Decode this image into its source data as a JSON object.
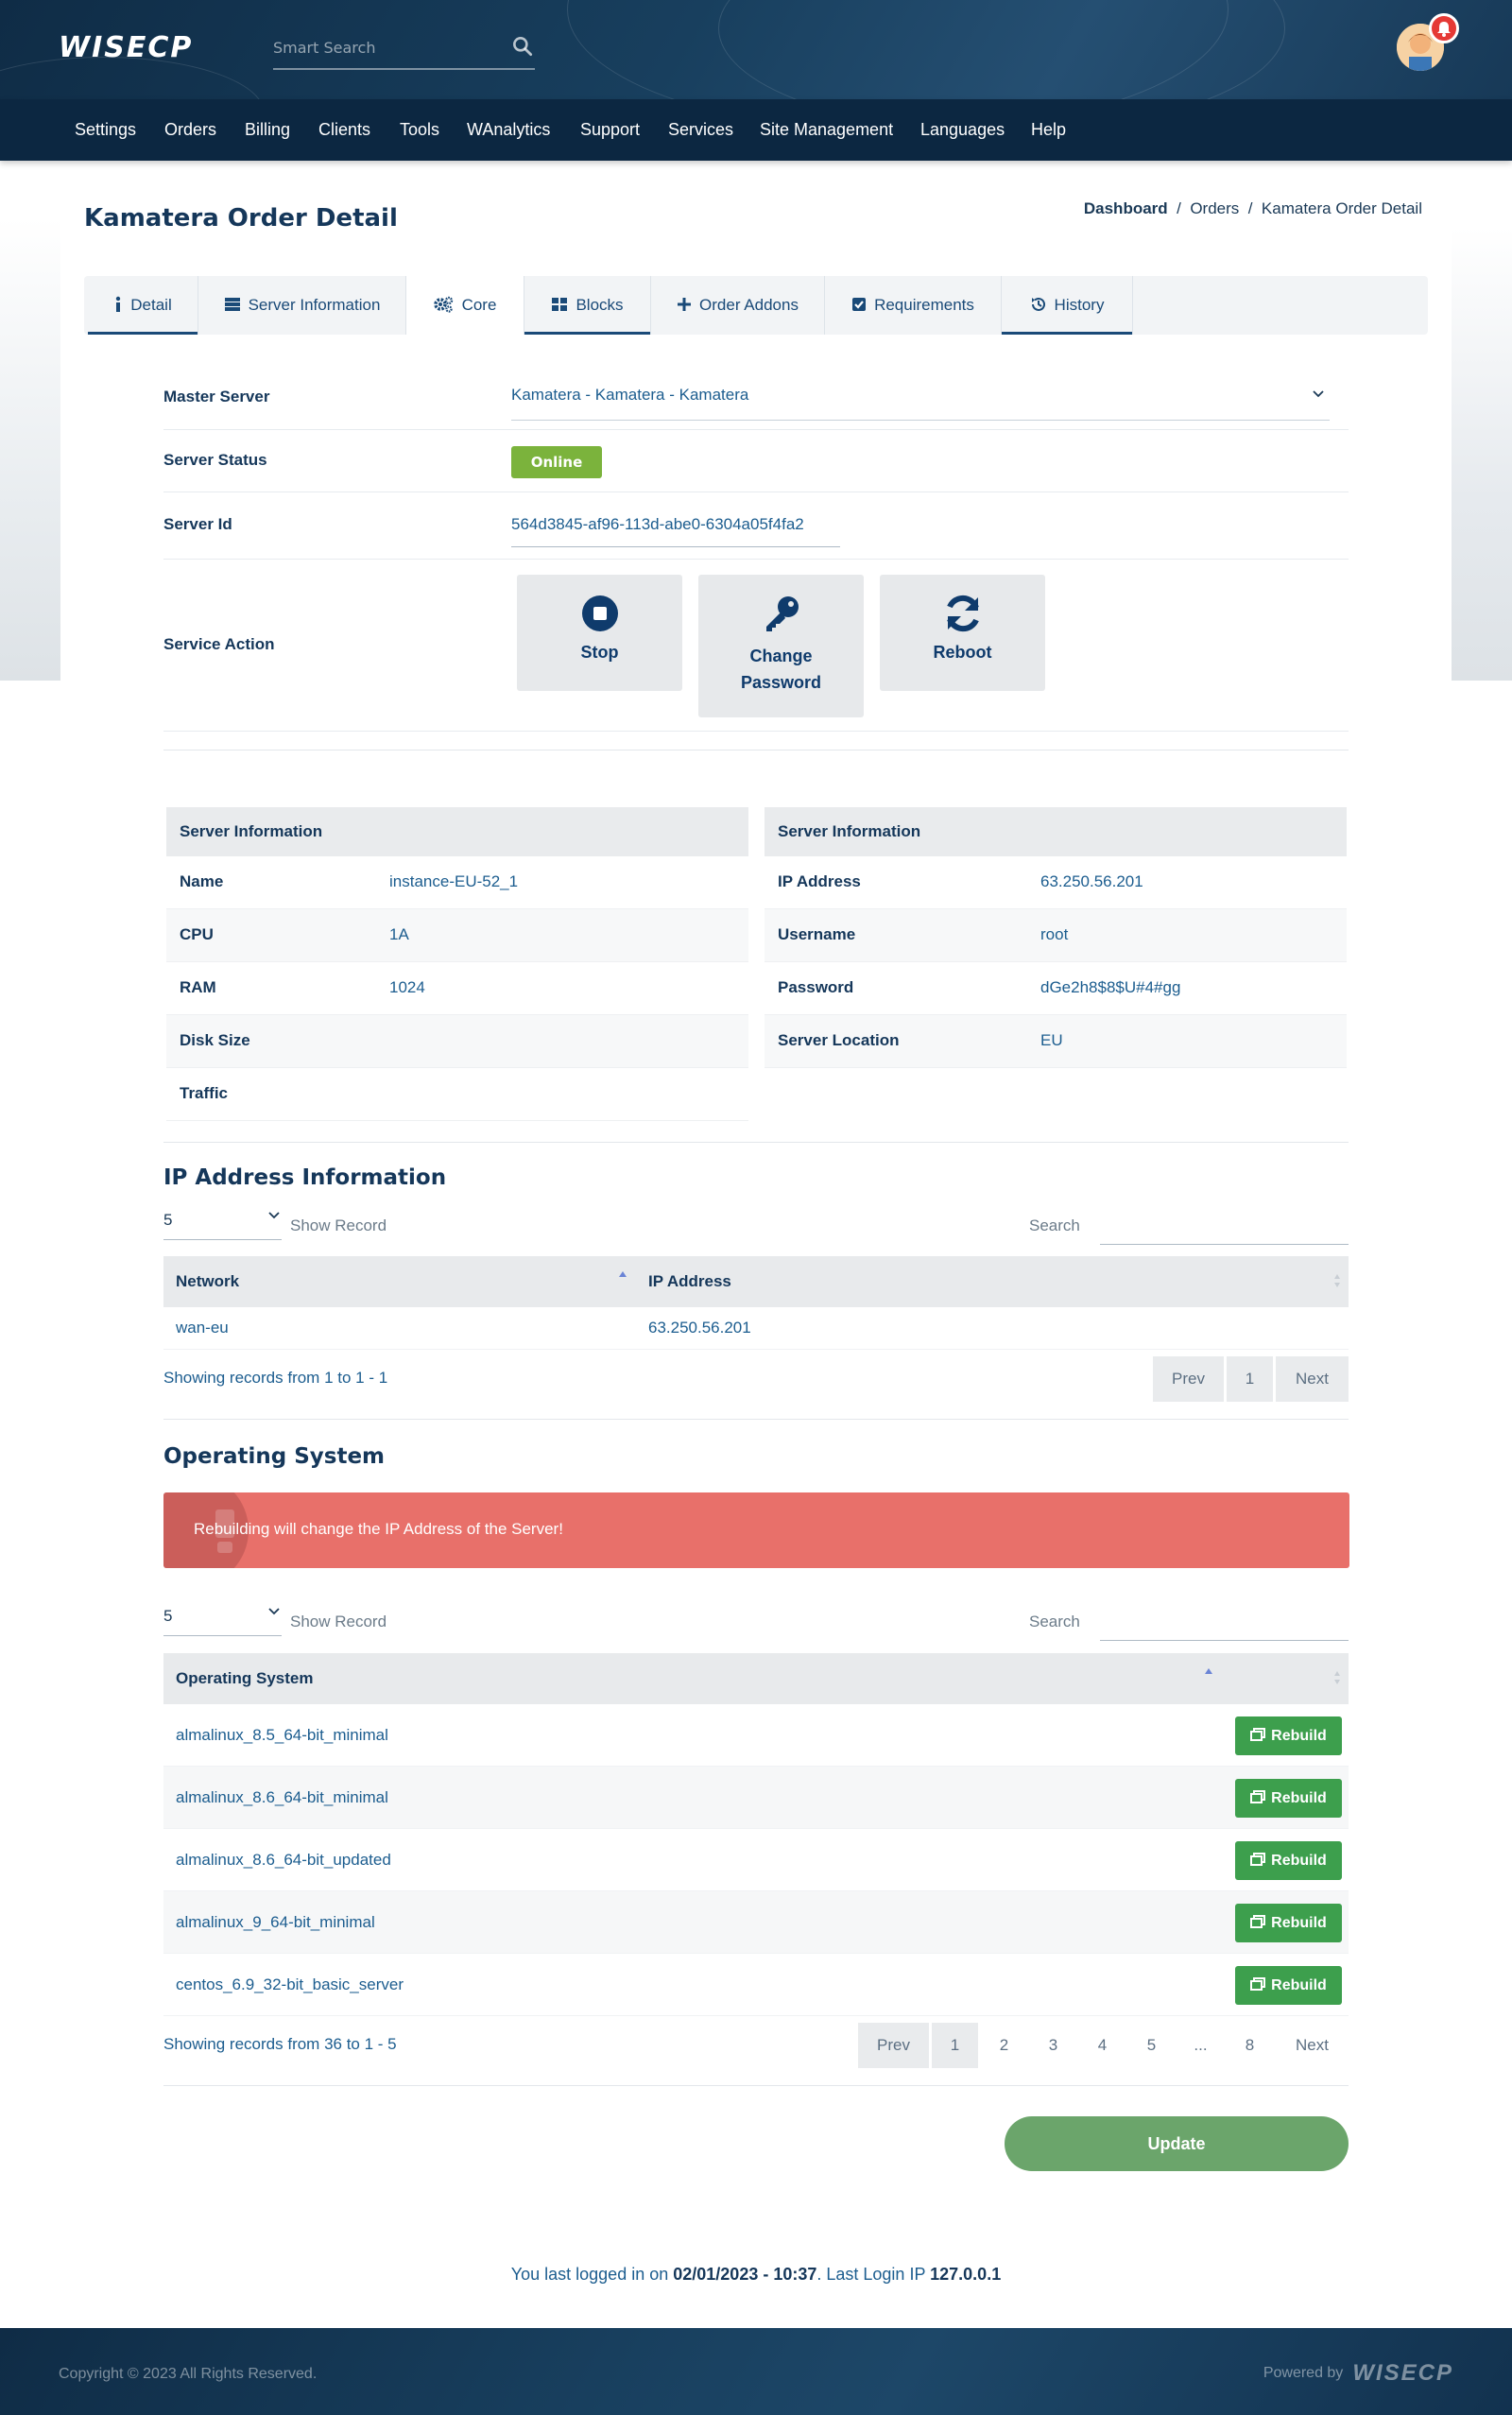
{
  "header": {
    "logo": "WISECP",
    "search_placeholder": "Smart Search",
    "nav": [
      "Settings",
      "Orders",
      "Billing",
      "Clients",
      "Tools",
      "WAnalytics",
      "Support",
      "Services",
      "Site Management",
      "Languages",
      "Help"
    ]
  },
  "page": {
    "title": "Kamatera Order Detail",
    "breadcrumb": [
      "Dashboard",
      "Orders",
      "Kamatera Order Detail"
    ]
  },
  "tabs": [
    {
      "label": "Detail",
      "icon": "info-icon"
    },
    {
      "label": "Server Information",
      "icon": "server-icon"
    },
    {
      "label": "Core",
      "icon": "cogs-icon"
    },
    {
      "label": "Blocks",
      "icon": "blocks-icon"
    },
    {
      "label": "Order Addons",
      "icon": "plus-icon"
    },
    {
      "label": "Requirements",
      "icon": "check-square-icon"
    },
    {
      "label": "History",
      "icon": "history-icon"
    }
  ],
  "active_tab": "Core",
  "form": {
    "master_server_label": "Master Server",
    "master_server_value": "Kamatera - Kamatera - Kamatera",
    "server_status_label": "Server Status",
    "server_status_value": "Online",
    "server_id_label": "Server Id",
    "server_id_value": "564d3845-af96-113d-abe0-6304a05f4fa2",
    "service_action_label": "Service Action"
  },
  "actions": [
    {
      "label": "Stop",
      "icon": "stop-icon"
    },
    {
      "label": "Change Password",
      "icon": "key-icon"
    },
    {
      "label": "Reboot",
      "icon": "reboot-icon"
    }
  ],
  "server_info_left": {
    "title": "Server Information",
    "rows": [
      {
        "key": "Name",
        "value": "instance-EU-52_1"
      },
      {
        "key": "CPU",
        "value": "1A"
      },
      {
        "key": "RAM",
        "value": "1024"
      },
      {
        "key": "Disk Size",
        "value": ""
      },
      {
        "key": "Traffic",
        "value": ""
      }
    ]
  },
  "server_info_right": {
    "title": "Server Information",
    "rows": [
      {
        "key": "IP Address",
        "value": "63.250.56.201"
      },
      {
        "key": "Username",
        "value": "root"
      },
      {
        "key": "Password",
        "value": "dGe2h8$8$U#4#gg"
      },
      {
        "key": "Server Location",
        "value": "EU"
      }
    ]
  },
  "ip_section": {
    "title": "IP Address Information",
    "page_length": "5",
    "show_record": "Show Record",
    "search_label": "Search",
    "columns": [
      "Network",
      "IP Address"
    ],
    "rows": [
      [
        "wan-eu",
        "63.250.56.201"
      ]
    ],
    "info": "Showing records from 1 to 1 - 1",
    "pagination": [
      "Prev",
      "1",
      "Next"
    ]
  },
  "os_section": {
    "title": "Operating System",
    "alert": "Rebuilding will change the IP Address of the Server!",
    "page_length": "5",
    "show_record": "Show Record",
    "search_label": "Search",
    "column": "Operating System",
    "button_label": "Rebuild",
    "rows": [
      "almalinux_8.5_64-bit_minimal",
      "almalinux_8.6_64-bit_minimal",
      "almalinux_8.6_64-bit_updated",
      "almalinux_9_64-bit_minimal",
      "centos_6.9_32-bit_basic_server"
    ],
    "info": "Showing records from 36 to 1 - 5",
    "pagination": [
      "Prev",
      "1",
      "2",
      "3",
      "4",
      "5",
      "...",
      "8",
      "Next"
    ]
  },
  "update_label": "Update",
  "last_login": {
    "prefix": "You last logged in on ",
    "datetime": "02/01/2023 - 10:37",
    "middle": ". Last Login IP ",
    "ip": "127.0.0.1"
  },
  "footer": {
    "copyright": "Copyright © 2023 All Rights Reserved.",
    "powered_by": "Powered by",
    "powered_logo": "WISECP"
  },
  "colors": {
    "header_bg": "#0f2c46",
    "accent": "#1a4a78",
    "online": "#7bb33c",
    "rebuild": "#3d9f4d",
    "alert": "#e8706a",
    "update": "#6ba56b"
  }
}
